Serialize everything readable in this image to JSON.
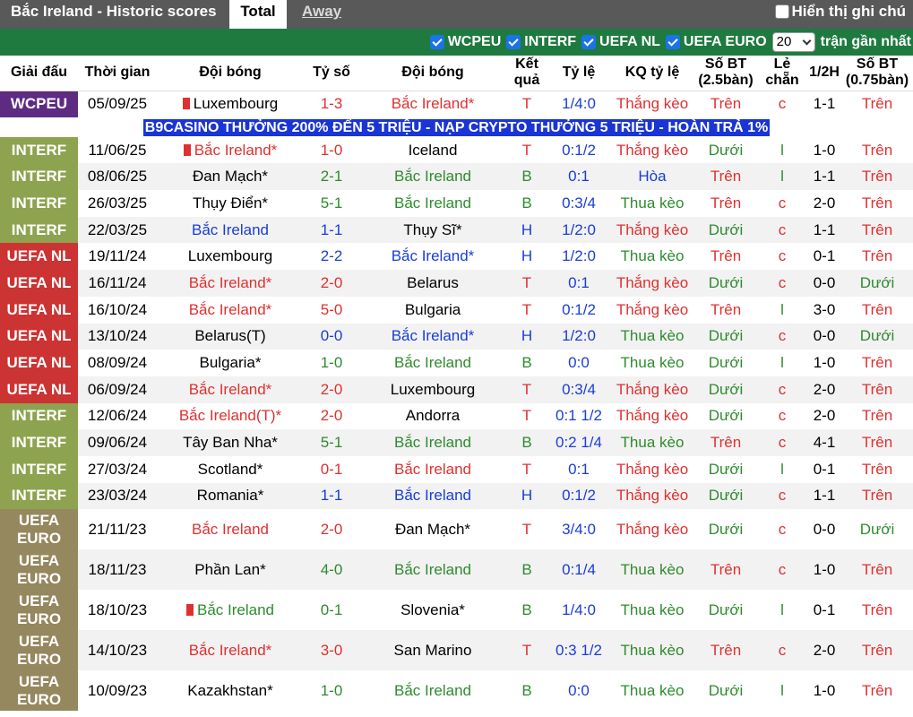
{
  "header": {
    "title": "Bắc Ireland - Historic scores",
    "tab_total": "Total",
    "tab_away": "Away",
    "handicap_label": "Hiển thị ghi chú"
  },
  "filters": {
    "items": [
      "WCPEU",
      "INTERF",
      "UEFA NL",
      "UEFA EURO"
    ],
    "count_value": "20",
    "count_suffix": "trận gần nhất"
  },
  "columns": [
    "Giải đấu",
    "Thời gian",
    "Đội bóng",
    "Tỷ số",
    "Đội bóng",
    "Kết quả",
    "Tỷ lệ",
    "KQ tỷ lệ",
    "Số BT (2.5bàn)",
    "Lẻ chẵn",
    "1/2H",
    "Số BT (0.75bàn)"
  ],
  "ad_text": "B9CASINO THƯỞNG 200% ĐẾN 5 TRIỆU - NẠP CRYPTO THƯỞNG 5 TRIỆU - HOÀN TRẢ 1%",
  "colors": {
    "result_win": "#e03030",
    "result_draw": "#1a3dd6",
    "result_loss": "#2e8b2e"
  },
  "rows": [
    {
      "league": "WCPEU",
      "kind": "wc",
      "date": "05/09/25",
      "home": "Luxembourg",
      "home_flag": true,
      "home_color": "",
      "score": "1-3",
      "away": "Bắc Ireland*",
      "away_color": "red",
      "result": "T",
      "odds": "1/4:0",
      "odds_result": "Thắng kèo",
      "ou": "Trên",
      "oe": "c",
      "half": "1-1",
      "ou2": "Trên"
    },
    {
      "league": "INTERF",
      "kind": "int",
      "date": "11/06/25",
      "home": "Bắc Ireland*",
      "home_flag": true,
      "home_color": "red",
      "score": "1-0",
      "away": "Iceland",
      "away_color": "",
      "result": "T",
      "odds": "0:1/2",
      "odds_result": "Thắng kèo",
      "ou": "Dưới",
      "oe": "l",
      "half": "1-0",
      "ou2": "Trên"
    },
    {
      "league": "INTERF",
      "kind": "int",
      "date": "08/06/25",
      "home": "Đan Mạch*",
      "home_flag": false,
      "home_color": "",
      "score": "2-1",
      "away": "Bắc Ireland",
      "away_color": "green",
      "result": "B",
      "odds": "0:1",
      "odds_result": "Hòa",
      "ou": "Trên",
      "oe": "l",
      "half": "1-1",
      "ou2": "Trên"
    },
    {
      "league": "INTERF",
      "kind": "int",
      "date": "26/03/25",
      "home": "Thụy Điển*",
      "home_flag": false,
      "home_color": "",
      "score": "5-1",
      "away": "Bắc Ireland",
      "away_color": "green",
      "result": "B",
      "odds": "0:3/4",
      "odds_result": "Thua kèo",
      "ou": "Trên",
      "oe": "c",
      "half": "2-0",
      "ou2": "Trên"
    },
    {
      "league": "INTERF",
      "kind": "int",
      "date": "22/03/25",
      "home": "Bắc Ireland",
      "home_flag": false,
      "home_color": "blue",
      "score": "1-1",
      "away": "Thụy Sĩ*",
      "away_color": "",
      "result": "H",
      "odds": "1/2:0",
      "odds_result": "Thắng kèo",
      "ou": "Dưới",
      "oe": "c",
      "half": "1-1",
      "ou2": "Trên"
    },
    {
      "league": "UEFA NL",
      "kind": "uefa",
      "date": "19/11/24",
      "home": "Luxembourg",
      "home_flag": false,
      "home_color": "",
      "score": "2-2",
      "away": "Bắc Ireland*",
      "away_color": "blue",
      "result": "H",
      "odds": "1/2:0",
      "odds_result": "Thua kèo",
      "ou": "Trên",
      "oe": "c",
      "half": "0-1",
      "ou2": "Trên"
    },
    {
      "league": "UEFA NL",
      "kind": "uefa",
      "date": "16/11/24",
      "home": "Bắc Ireland*",
      "home_flag": false,
      "home_color": "red",
      "score": "2-0",
      "away": "Belarus",
      "away_color": "",
      "result": "T",
      "odds": "0:1",
      "odds_result": "Thắng kèo",
      "ou": "Dưới",
      "oe": "c",
      "half": "0-0",
      "ou2": "Dưới"
    },
    {
      "league": "UEFA NL",
      "kind": "uefa",
      "date": "16/10/24",
      "home": "Bắc Ireland*",
      "home_flag": false,
      "home_color": "red",
      "score": "5-0",
      "away": "Bulgaria",
      "away_color": "",
      "result": "T",
      "odds": "0:1/2",
      "odds_result": "Thắng kèo",
      "ou": "Trên",
      "oe": "l",
      "half": "3-0",
      "ou2": "Trên"
    },
    {
      "league": "UEFA NL",
      "kind": "uefa",
      "date": "13/10/24",
      "home": "Belarus(T)",
      "home_flag": false,
      "home_color": "",
      "score": "0-0",
      "away": "Bắc Ireland*",
      "away_color": "blue",
      "result": "H",
      "odds": "1/2:0",
      "odds_result": "Thua kèo",
      "ou": "Dưới",
      "oe": "c",
      "half": "0-0",
      "ou2": "Dưới"
    },
    {
      "league": "UEFA NL",
      "kind": "uefa",
      "date": "08/09/24",
      "home": "Bulgaria*",
      "home_flag": false,
      "home_color": "",
      "score": "1-0",
      "away": "Bắc Ireland",
      "away_color": "green",
      "result": "B",
      "odds": "0:0",
      "odds_result": "Thua kèo",
      "ou": "Dưới",
      "oe": "l",
      "half": "1-0",
      "ou2": "Trên"
    },
    {
      "league": "UEFA NL",
      "kind": "uefa",
      "date": "06/09/24",
      "home": "Bắc Ireland*",
      "home_flag": false,
      "home_color": "red",
      "score": "2-0",
      "away": "Luxembourg",
      "away_color": "",
      "result": "T",
      "odds": "0:3/4",
      "odds_result": "Thắng kèo",
      "ou": "Dưới",
      "oe": "c",
      "half": "2-0",
      "ou2": "Trên"
    },
    {
      "league": "INTERF",
      "kind": "int",
      "date": "12/06/24",
      "home": "Bắc Ireland(T)*",
      "home_flag": false,
      "home_color": "red",
      "score": "2-0",
      "away": "Andorra",
      "away_color": "",
      "result": "T",
      "odds": "0:1 1/2",
      "odds_result": "Thắng kèo",
      "ou": "Dưới",
      "oe": "c",
      "half": "2-0",
      "ou2": "Trên"
    },
    {
      "league": "INTERF",
      "kind": "int",
      "date": "09/06/24",
      "home": "Tây Ban Nha*",
      "home_flag": false,
      "home_color": "",
      "score": "5-1",
      "away": "Bắc Ireland",
      "away_color": "green",
      "result": "B",
      "odds": "0:2 1/4",
      "odds_result": "Thua kèo",
      "ou": "Trên",
      "oe": "c",
      "half": "4-1",
      "ou2": "Trên"
    },
    {
      "league": "INTERF",
      "kind": "int",
      "date": "27/03/24",
      "home": "Scotland*",
      "home_flag": false,
      "home_color": "",
      "score": "0-1",
      "away": "Bắc Ireland",
      "away_color": "red",
      "result": "T",
      "odds": "0:1",
      "odds_result": "Thắng kèo",
      "ou": "Dưới",
      "oe": "l",
      "half": "0-1",
      "ou2": "Trên"
    },
    {
      "league": "INTERF",
      "kind": "int",
      "date": "23/03/24",
      "home": "Romania*",
      "home_flag": false,
      "home_color": "",
      "score": "1-1",
      "away": "Bắc Ireland",
      "away_color": "blue",
      "result": "H",
      "odds": "0:1/2",
      "odds_result": "Thắng kèo",
      "ou": "Dưới",
      "oe": "c",
      "half": "1-1",
      "ou2": "Trên"
    },
    {
      "league": "UEFA EURO",
      "kind": "euro",
      "date": "21/11/23",
      "home": "Bắc Ireland",
      "home_flag": false,
      "home_color": "red",
      "score": "2-0",
      "away": "Đan Mạch*",
      "away_color": "",
      "result": "T",
      "odds": "3/4:0",
      "odds_result": "Thắng kèo",
      "ou": "Dưới",
      "oe": "c",
      "half": "0-0",
      "ou2": "Dưới"
    },
    {
      "league": "UEFA EURO",
      "kind": "euro",
      "date": "18/11/23",
      "home": "Phần Lan*",
      "home_flag": false,
      "home_color": "",
      "score": "4-0",
      "away": "Bắc Ireland",
      "away_color": "green",
      "result": "B",
      "odds": "0:1/4",
      "odds_result": "Thua kèo",
      "ou": "Trên",
      "oe": "c",
      "half": "1-0",
      "ou2": "Trên"
    },
    {
      "league": "UEFA EURO",
      "kind": "euro",
      "date": "18/10/23",
      "home": "Bắc Ireland",
      "home_flag": true,
      "home_color": "green",
      "score": "0-1",
      "away": "Slovenia*",
      "away_color": "",
      "result": "B",
      "odds": "1/4:0",
      "odds_result": "Thua kèo",
      "ou": "Dưới",
      "oe": "l",
      "half": "0-1",
      "ou2": "Trên"
    },
    {
      "league": "UEFA EURO",
      "kind": "euro",
      "date": "14/10/23",
      "home": "Bắc Ireland*",
      "home_flag": false,
      "home_color": "red",
      "score": "3-0",
      "away": "San Marino",
      "away_color": "",
      "result": "T",
      "odds": "0:3 1/2",
      "odds_result": "Thua kèo",
      "ou": "Trên",
      "oe": "c",
      "half": "2-0",
      "ou2": "Trên"
    },
    {
      "league": "UEFA EURO",
      "kind": "euro",
      "date": "10/09/23",
      "home": "Kazakhstan*",
      "home_flag": false,
      "home_color": "",
      "score": "1-0",
      "away": "Bắc Ireland",
      "away_color": "green",
      "result": "B",
      "odds": "0:0",
      "odds_result": "Thua kèo",
      "ou": "Dưới",
      "oe": "l",
      "half": "1-0",
      "ou2": "Trên"
    }
  ]
}
